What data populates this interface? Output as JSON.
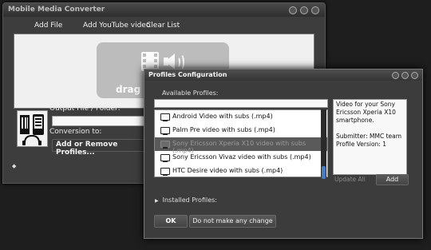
{
  "main_window": {
    "title": "Mobile Media Converter",
    "toolbar": {
      "add_file": "Add File",
      "add_youtube": "Add YouTube video",
      "clear_list": "Clear List"
    },
    "drop_text": "drag &",
    "output_label": "Output File / Folder:",
    "conversion_label": "Conversion to:",
    "add_remove_profiles": "Add or Remove Profiles..."
  },
  "dialog": {
    "title": "Profiles Configuration",
    "available_label": "Available Profiles:",
    "profiles": [
      {
        "label": "Android Video with subs (.mp4)"
      },
      {
        "label": "Palm Pre video with subs (.mp4)"
      },
      {
        "label": "Sony Ericsson Xperia X10 video with subs (.mp4)"
      },
      {
        "label": "Sony Ericsson Vivaz video with subs (.mp4)"
      },
      {
        "label": "HTC Desire video with subs (.mp4)"
      }
    ],
    "description": {
      "line1": "Video for your Sony Ericsson Xperia X10 smartphone.",
      "submitter": "Submitter: MMC team",
      "version": "Profile Version: 1"
    },
    "update_all": "Update All",
    "add": "Add",
    "installed_label": "Installed Profiles:",
    "ok": "OK",
    "no_change": "Do not make any change"
  }
}
